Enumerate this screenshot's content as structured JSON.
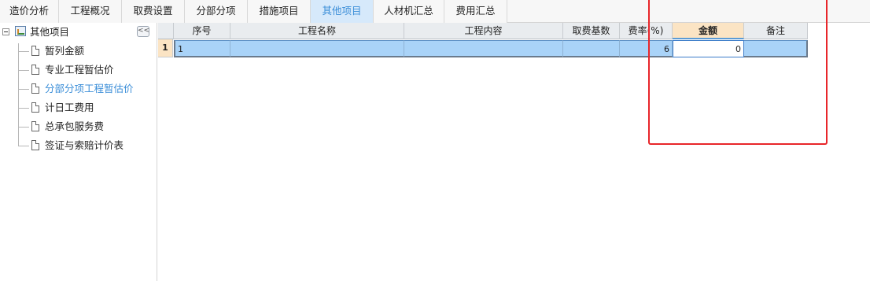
{
  "tabs": [
    {
      "label": "造价分析",
      "active": false
    },
    {
      "label": "工程概况",
      "active": false
    },
    {
      "label": "取费设置",
      "active": false
    },
    {
      "label": "分部分项",
      "active": false
    },
    {
      "label": "措施项目",
      "active": false
    },
    {
      "label": "其他项目",
      "active": true
    },
    {
      "label": "人材机汇总",
      "active": false
    },
    {
      "label": "费用汇总",
      "active": false
    }
  ],
  "sidebar": {
    "collapse_label": "<<",
    "root": {
      "label": "其他项目",
      "icon": "folder-tree-icon"
    },
    "items": [
      {
        "label": "暂列金额",
        "icon": "document-icon",
        "selected": false
      },
      {
        "label": "专业工程暂估价",
        "icon": "document-icon",
        "selected": false
      },
      {
        "label": "分部分项工程暂估价",
        "icon": "document-icon",
        "selected": true
      },
      {
        "label": "计日工费用",
        "icon": "document-icon",
        "selected": false
      },
      {
        "label": "总承包服务费",
        "icon": "document-icon",
        "selected": false
      },
      {
        "label": "签证与索赔计价表",
        "icon": "document-icon",
        "selected": false
      }
    ]
  },
  "grid": {
    "columns": [
      "序号",
      "工程名称",
      "工程内容",
      "取费基数",
      "费率(%)",
      "金额",
      "备注"
    ],
    "selected_column": "金额",
    "rows": [
      {
        "row_num": "1",
        "cells": [
          "1",
          "",
          "",
          "",
          "6",
          "0",
          ""
        ]
      }
    ]
  },
  "colors": {
    "accent": "#3b8ed8",
    "selection_row": "#a9d3f8",
    "highlight_header": "#fbe4c4",
    "annotation": "#e8262a"
  }
}
